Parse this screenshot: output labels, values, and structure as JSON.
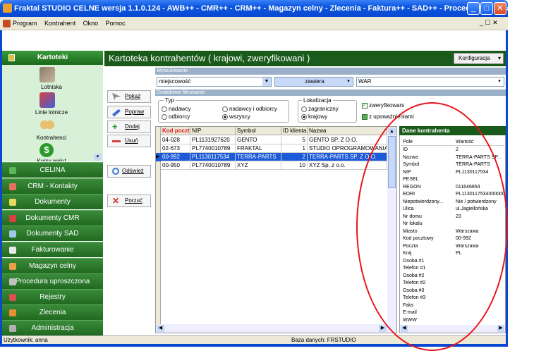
{
  "window": {
    "title": "Fraktal STUDIO CELNE  wersja 1.1.0.124 - AWB++ - CMR++ - CRM++ - Magazyn celny - Zlecenia - Faktura++ - SAD++ - Procedura++ - [Kar...",
    "btn_min": "_",
    "btn_max": "□",
    "btn_close": "✕"
  },
  "menu": {
    "items": [
      "Program",
      "Kontrahent",
      "Okno",
      "Pomoc"
    ],
    "mdi_controls": "_ ☐ ✕"
  },
  "left": {
    "header": "Kartoteki",
    "icons": [
      {
        "label": "Lotniska",
        "icon": "book-icon"
      },
      {
        "label": "Linie lotnicze",
        "icon": "airline-icon"
      },
      {
        "label": "Kontrahenci",
        "icon": "people-icon"
      },
      {
        "label": "Kursy walut",
        "icon": "dollar-icon"
      }
    ],
    "nav": [
      "CELINA",
      "CRM - Kontakty",
      "Dokumenty",
      "Dokumenty CMR",
      "Dokumenty SAD",
      "Fakturowanie",
      "Magazyn celny",
      "Procedura uproszczona",
      "Rejestry",
      "Zlecenia",
      "Administracja"
    ]
  },
  "main": {
    "title": "Kartoteka kontrahentów ( krajowi, zweryfikowani )",
    "config_btn": "Konfiguracja"
  },
  "buttons": {
    "show": "Pokaż",
    "edit": "Popraw",
    "add": "Dodaj",
    "delete": "Usuń",
    "refresh": "Odśwież",
    "cancel": "Porzuć"
  },
  "search": {
    "section": "Wyszukiwanie",
    "field": "miejscowość",
    "mode": "zawiera",
    "value": "WAR"
  },
  "filter": {
    "section": "Dodatkowe filtrowanie",
    "typ_label": "Typ",
    "typ_opts": [
      "nadawcy",
      "odbiorcy",
      "nadawcy i odbiorcy",
      "wszyscy"
    ],
    "typ_selected": "wszyscy",
    "lok_label": "Lokalizacja",
    "lok_opts": [
      "zagraniczny",
      "krajowy"
    ],
    "lok_selected": "krajowy",
    "chk_verified": "zweryfikowani",
    "chk_auth": "z upoważnieniami"
  },
  "table": {
    "columns": [
      "Kod pocztowy",
      "NIP",
      "Symbol",
      "ID klienta",
      "Nazwa"
    ],
    "rows": [
      [
        "04-028",
        "PL1131927620",
        "GENTO",
        "5",
        "GENTO SP. Z O.O."
      ],
      [
        "02-673",
        "PL7740010789",
        "FRAKTAL",
        "1",
        "STUDIO OPROGRAMOWANIA"
      ],
      [
        "00-992",
        "PL1130117534",
        "TERRA-PARTS",
        "2",
        "TERRA-PARTS SP. Z O.O."
      ],
      [
        "00-950",
        "PL7740010789",
        "XYZ",
        "10",
        "XYZ Sp. z o.o."
      ]
    ],
    "selected": 2
  },
  "details": {
    "header": "Dane kontrahenta",
    "col_field": "Pole",
    "col_value": "Wartość",
    "rows": [
      [
        "ID",
        "2"
      ],
      [
        "Nazwa",
        "TERRA-PARTS SP. ."
      ],
      [
        "Symbol",
        "TERRA-PARTS"
      ],
      [
        "NIP",
        "PL1130117534"
      ],
      [
        "PESEL",
        ""
      ],
      [
        "REGON",
        "011646854"
      ],
      [
        "EORI",
        "PL1130117534000000"
      ],
      [
        "Niepotwierdzony...",
        "Nie / potwierdzony"
      ],
      [
        "Ulica",
        "ul.Jagiellońska"
      ],
      [
        "Nr domu",
        "23"
      ],
      [
        "Nr lokalu",
        ""
      ],
      [
        "Miasto",
        "Warszawa"
      ],
      [
        "Kod pocztowy",
        "00-992"
      ],
      [
        "Poczta",
        "Warszawa"
      ],
      [
        "Kraj",
        "PL"
      ],
      [
        "Osoba #1",
        ""
      ],
      [
        "Telefon #1",
        ""
      ],
      [
        "Osoba #2",
        ""
      ],
      [
        "Telefon #2",
        ""
      ],
      [
        "Osoba #3",
        ""
      ],
      [
        "Telefon #3",
        ""
      ],
      [
        "Faks",
        ""
      ],
      [
        "E-mail",
        ""
      ],
      [
        "WWW",
        ""
      ]
    ]
  },
  "status": {
    "user": "Użytkownik: anna",
    "db": "Baza danych: FRSTUDIO"
  },
  "colors": {
    "accent_green": "#1a5a1a",
    "selection": "#1c5ad8",
    "annotation": "#e8141c"
  }
}
